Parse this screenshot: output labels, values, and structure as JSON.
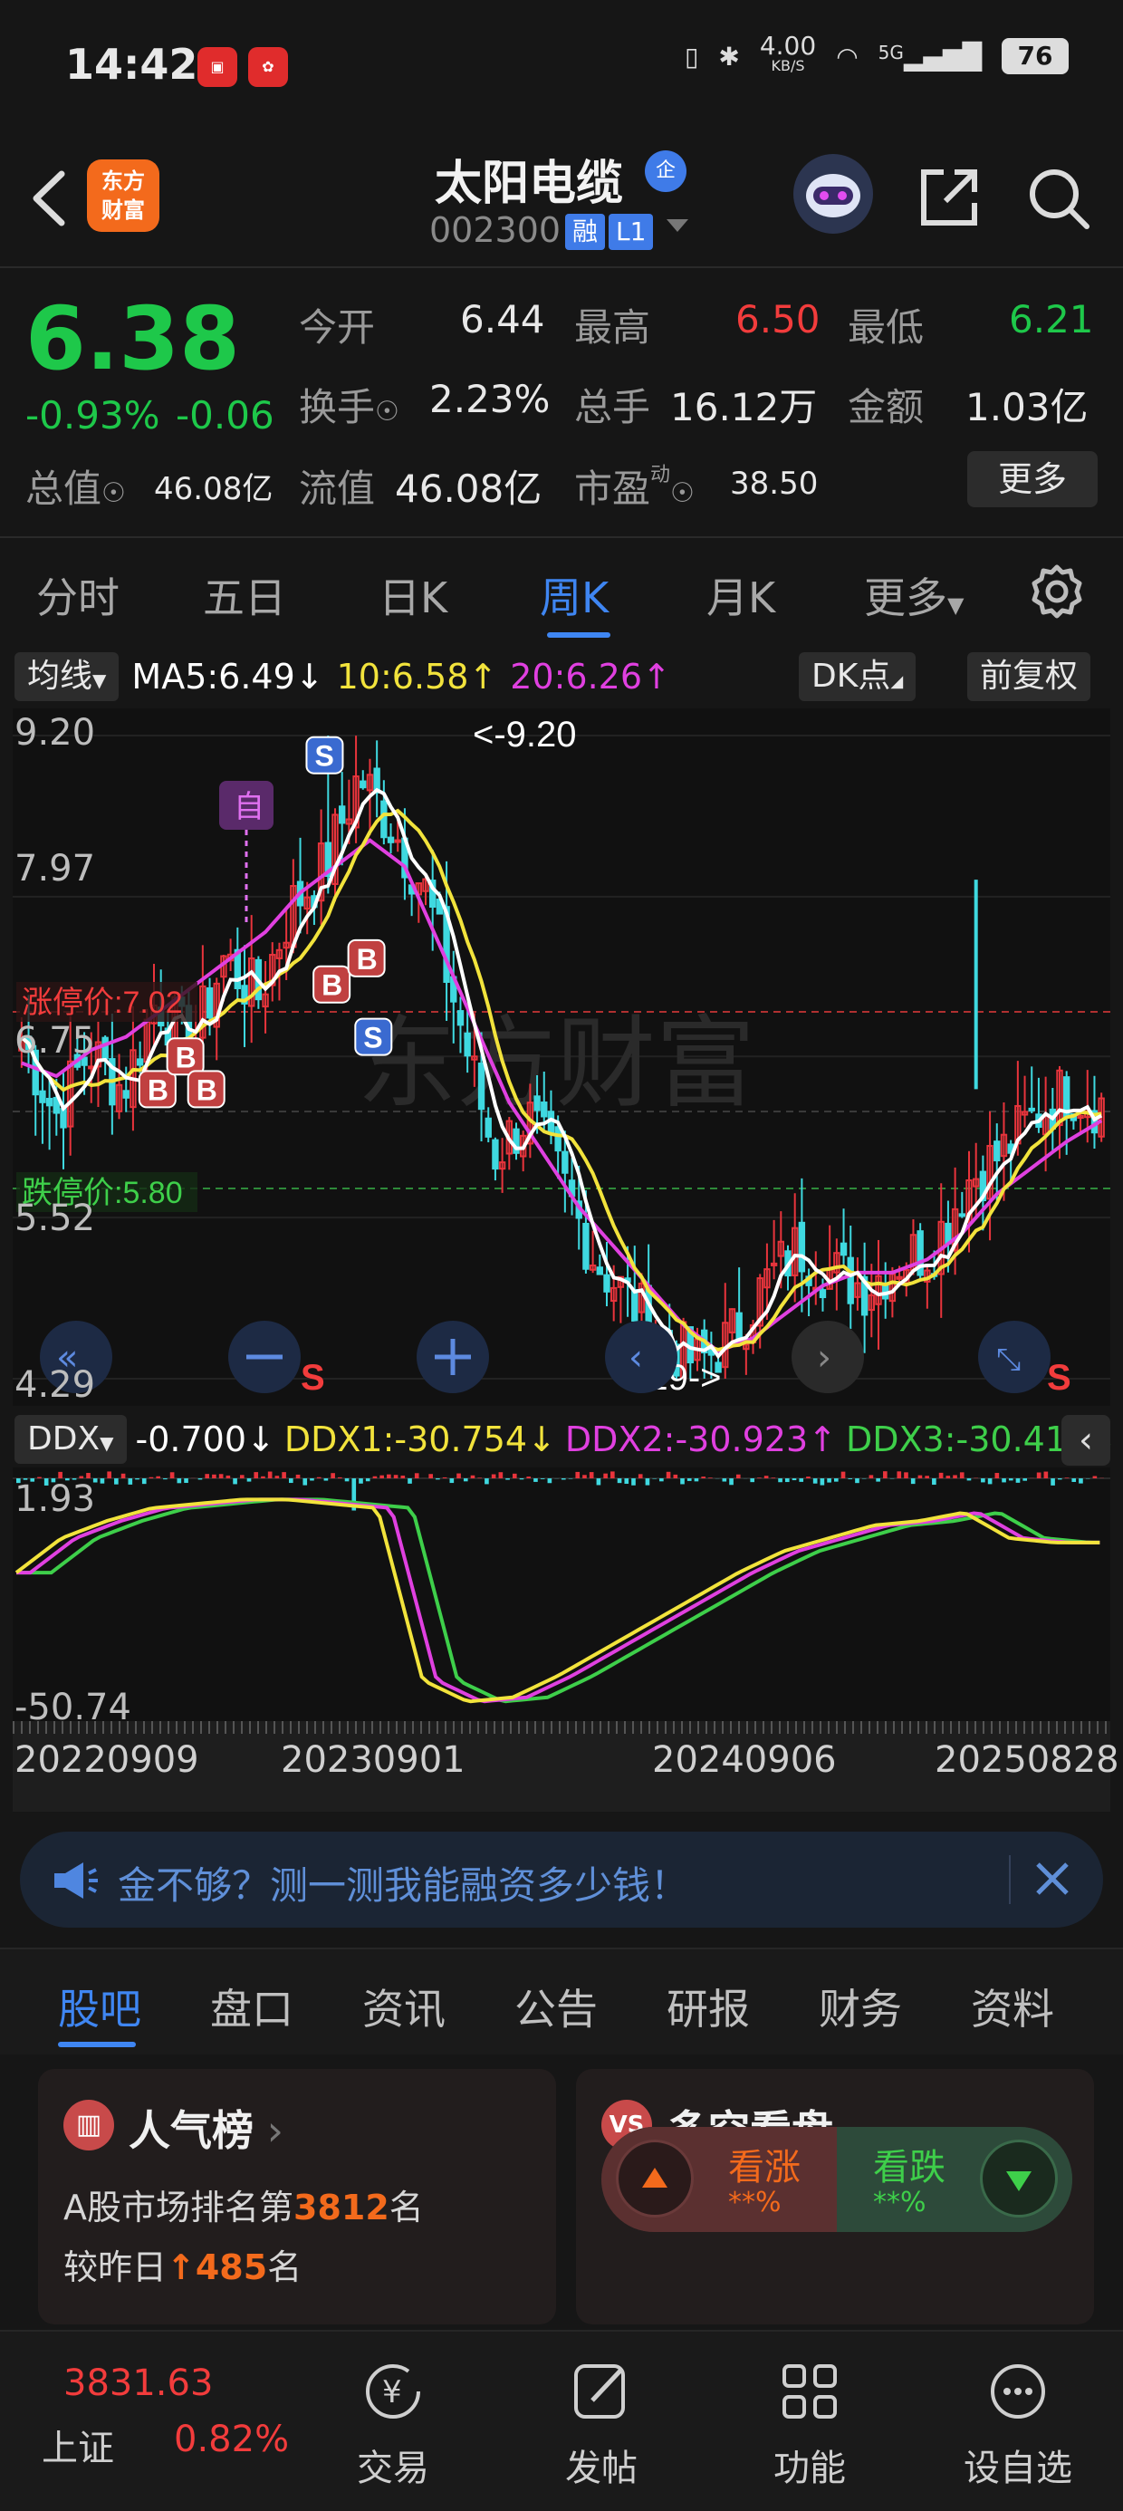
{
  "status_bar": {
    "time": "14:42",
    "app1": "小红书",
    "network_speed": "4.00",
    "network_unit": "KB/S",
    "signal": "5G",
    "battery": "76"
  },
  "header": {
    "logo_line1": "东方",
    "logo_line2": "财富",
    "stock_name": "太阳电缆",
    "qi_badge": "企",
    "stock_code": "002300",
    "margin_badge": "融",
    "level_badge": "L1"
  },
  "quote": {
    "price": "6.38",
    "change_pct": "-0.93%",
    "change_abs": "-0.06",
    "open_label": "今开",
    "open": "6.44",
    "high_label": "最高",
    "high": "6.50",
    "low_label": "最低",
    "low": "6.21",
    "turnover_label": "换手",
    "turnover": "2.23%",
    "volume_label": "总手",
    "volume": "16.12万",
    "amount_label": "金额",
    "amount": "1.03亿",
    "mktcap_label": "总值",
    "mktcap": "46.08亿",
    "float_label": "流值",
    "float": "46.08亿",
    "pe_label": "市盈",
    "pe_sup": "动",
    "pe": "38.50",
    "more_label": "更多",
    "colors": {
      "up": "#f23c3c",
      "down": "#1ec84a"
    }
  },
  "period_tabs": [
    "分时",
    "五日",
    "日K",
    "周K",
    "月K",
    "更多"
  ],
  "active_tab": "周K",
  "ma_bar": {
    "type_chip": "均线",
    "ma5": "MA5:6.49",
    "ma10": "10:6.58",
    "ma20": "20:6.26",
    "dk_chip": "DK点",
    "adjust_chip": "前复权",
    "colors": {
      "ma5": "#ffffff",
      "ma10": "#f2e33c",
      "ma20": "#e040e0"
    }
  },
  "kline": {
    "y_labels": [
      "9.20",
      "7.97",
      "6.75",
      "5.52",
      "4.29"
    ],
    "high_marker": "<-9.20",
    "low_marker": "4.29->",
    "limit_up_label": "涨停价:7.02",
    "limit_down_label": "跌停价:5.80",
    "watermark": "东方财富",
    "self_marker": "自"
  },
  "ddx_bar": {
    "chip": "DDX",
    "ddx": "-0.700",
    "ddx1": "DDX1:-30.754",
    "ddx2": "DDX2:-30.923",
    "ddx3": "DDX3:-30.415",
    "colors": {
      "ddx1": "#f2e33c",
      "ddx2": "#e040e0",
      "ddx3": "#3ecf4a"
    }
  },
  "ddx_axis": {
    "top": "1.93",
    "bottom": "-50.74"
  },
  "dates": [
    "20220909",
    "20230901",
    "20240906",
    "20250828"
  ],
  "banner": {
    "text": "金不够？测一测我能融资多少钱！"
  },
  "bottom_tabs": [
    "股吧",
    "盘口",
    "资讯",
    "公告",
    "研报",
    "财务",
    "资料"
  ],
  "popularity": {
    "title": "人气榜",
    "line1_prefix": "A股市场排名第",
    "rank": "3812",
    "line1_suffix": "名",
    "line2_prefix": "较昨日",
    "delta": "485",
    "line2_suffix": "名"
  },
  "bull_bear": {
    "title": "多空看盘",
    "bull_label": "看涨",
    "bull_value": "**%",
    "bear_label": "看跌",
    "bear_value": "**%"
  },
  "bottom_nav": {
    "index_value": "3831.63",
    "index_name": "上证",
    "index_change": "0.82%",
    "trade": "交易",
    "post": "发帖",
    "function": "功能",
    "watchlist": "设自选"
  },
  "chart_data": {
    "type": "candlestick",
    "period": "weekly",
    "x_range": [
      "20220909",
      "20250828"
    ],
    "ylim": [
      4.29,
      9.2
    ],
    "y_ticks": [
      9.2,
      7.97,
      6.75,
      5.52,
      4.29
    ],
    "annotations": {
      "period_high": 9.2,
      "period_low": 4.29,
      "limit_up": 7.02,
      "limit_down": 5.8
    },
    "ma_latest": {
      "MA5": 6.49,
      "MA10": 6.58,
      "MA20": 6.26
    },
    "ddx_latest": {
      "DDX": -0.7,
      "DDX1": -30.754,
      "DDX2": -30.923,
      "DDX3": -30.415
    },
    "ddx_ylim": [
      -50.74,
      1.93
    ],
    "close_path": [
      6.9,
      6.3,
      6.8,
      6.5,
      7.2,
      6.8,
      7.5,
      7.2,
      7.9,
      8.2,
      8.9,
      8.5,
      8.0,
      7.0,
      6.0,
      6.3,
      5.8,
      5.2,
      4.9,
      4.6,
      4.4,
      4.6,
      5.0,
      5.3,
      5.1,
      5.0,
      5.2,
      5.3,
      5.8,
      6.0,
      6.3,
      6.5,
      6.38
    ],
    "ma20_path": [
      6.7,
      6.6,
      6.8,
      6.9,
      7.1,
      7.3,
      7.5,
      7.7,
      8.0,
      8.2,
      8.4,
      8.2,
      7.6,
      7.0,
      6.4,
      6.0,
      5.6,
      5.3,
      5.0,
      4.7,
      4.5,
      4.6,
      4.8,
      5.0,
      5.1,
      5.1,
      5.2,
      5.4,
      5.7,
      5.9,
      6.1,
      6.26
    ],
    "ddx1_path": [
      -20,
      -12,
      -8,
      -5,
      -4,
      -3,
      -3,
      -4,
      -5,
      -45,
      -50,
      -49,
      -44,
      -38,
      -32,
      -26,
      -20,
      -15,
      -12,
      -9,
      -8,
      -6,
      -12,
      -13,
      -13
    ]
  }
}
